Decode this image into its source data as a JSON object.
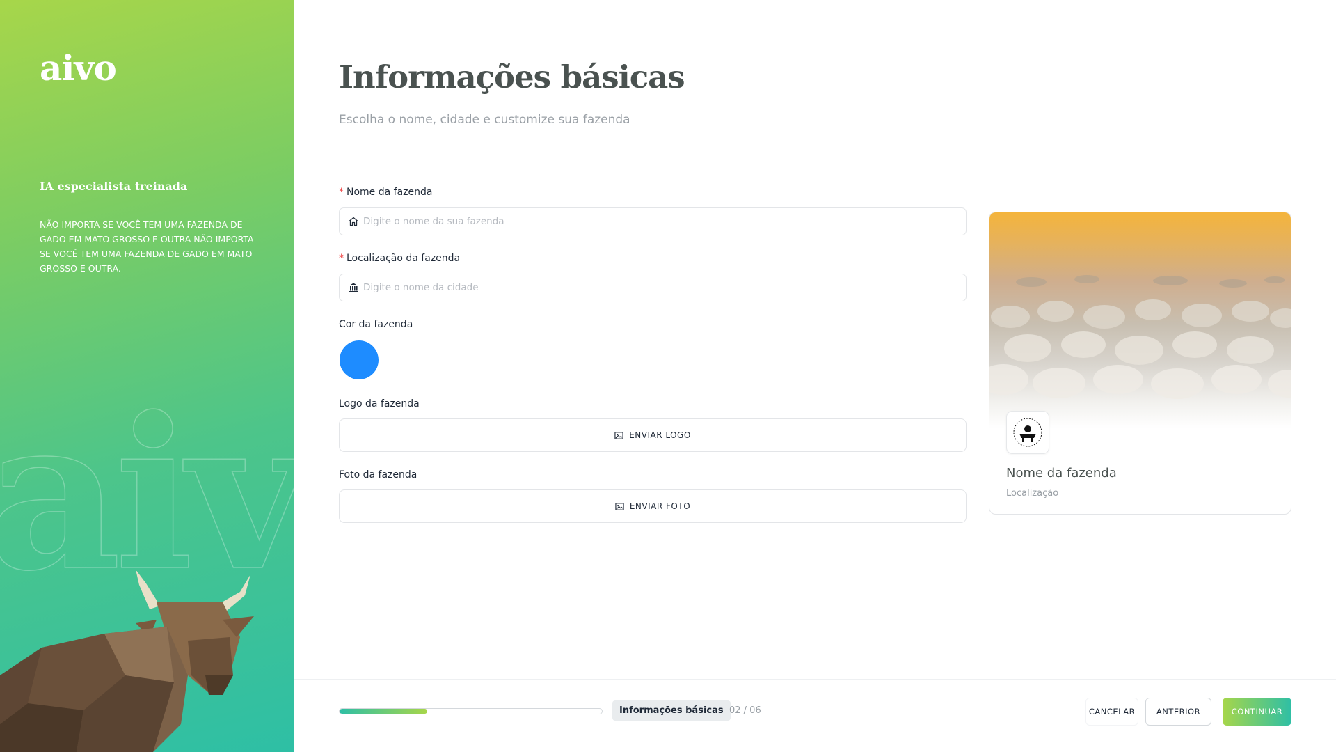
{
  "brand": {
    "logo": "aivo"
  },
  "sidebar": {
    "heading": "IA especialista treinada",
    "text": "Não importa se você tem uma fazenda de gado em Mato Grosso e outra não importa se você tem uma fazenda de gado em Mato Grosso e outra.",
    "watermark": "aivo"
  },
  "page": {
    "title": "Informações básicas",
    "subtitle": "Escolha o nome, cidade e customize sua fazenda"
  },
  "form": {
    "name_label": "Nome da fazenda",
    "name_placeholder": "Digite o nome da sua fazenda",
    "location_label": "Localização da fazenda",
    "location_placeholder": "Digite o nome da cidade",
    "color_label": "Cor da fazenda",
    "color_value": "#1e8cff",
    "logo_label": "Logo da fazenda",
    "logo_button": "ENVIAR LOGO",
    "photo_label": "Foto da fazenda",
    "photo_button": "ENVIAR FOTO",
    "required_mark": "*"
  },
  "preview": {
    "name": "Nome da fazenda",
    "location": "Localização"
  },
  "footer": {
    "progress": 0.333,
    "step_label": "Informações básicas",
    "step_count": "02 / 06",
    "cancel": "CANCELAR",
    "previous": "ANTERIOR",
    "continue": "CONTINUAR"
  },
  "colors": {
    "gradient_start": "#a7d64a",
    "gradient_end": "#2ebfa5",
    "title": "#4a5250",
    "accent_blue": "#1e8cff",
    "required": "#ef4444"
  },
  "icons": {
    "name_input": "home-icon",
    "location_input": "bank-icon",
    "upload": "image-icon"
  }
}
